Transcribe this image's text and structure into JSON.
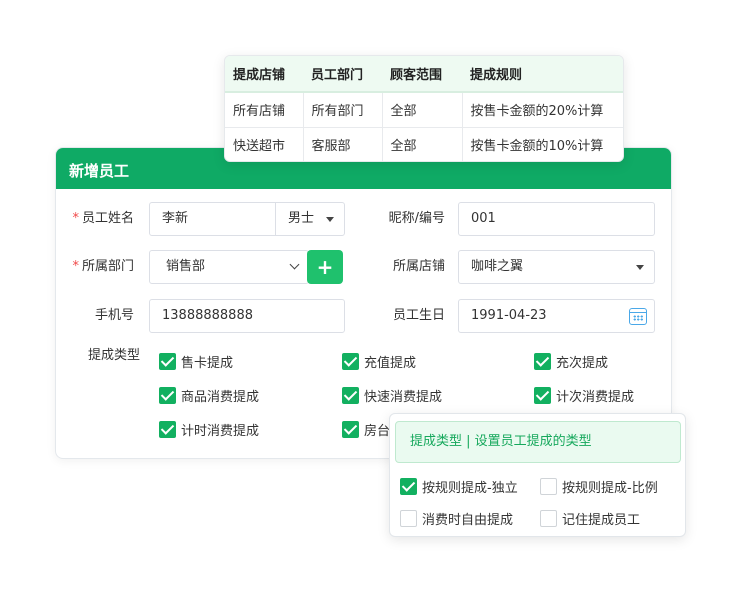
{
  "rules_table": {
    "headers": [
      "提成店铺",
      "员工部门",
      "顾客范围",
      "提成规则"
    ],
    "rows": [
      [
        "所有店铺",
        "所有部门",
        "全部",
        "按售卡金额的20%计算"
      ],
      [
        "快送超市",
        "客服部",
        "全部",
        "按售卡金额的10%计算"
      ]
    ]
  },
  "form": {
    "title": "新增员工",
    "required_mark": "*",
    "name_label": "员工姓名",
    "name_value": "李新",
    "gender_value": "男士",
    "nickname_label": "昵称/编号",
    "nickname_value": "001",
    "dept_label": "所属部门",
    "dept_value": "销售部",
    "add_dept_symbol": "+",
    "store_label": "所属店铺",
    "store_value": "咖啡之翼",
    "phone_label": "手机号",
    "phone_value": "13888888888",
    "birthday_label": "员工生日",
    "birthday_value": "1991-04-23",
    "commission_label": "提成类型",
    "commission_types": [
      {
        "label": "售卡提成",
        "checked": true
      },
      {
        "label": "充值提成",
        "checked": true
      },
      {
        "label": "充次提成",
        "checked": true
      },
      {
        "label": "商品消费提成",
        "checked": true
      },
      {
        "label": "快速消费提成",
        "checked": true
      },
      {
        "label": "计次消费提成",
        "checked": true
      },
      {
        "label": "计时消费提成",
        "checked": true
      },
      {
        "label": "房台",
        "checked": true
      }
    ]
  },
  "type_popup": {
    "header": "提成类型 | 设置员工提成的类型",
    "options": [
      {
        "label": "按规则提成-独立",
        "checked": true
      },
      {
        "label": "按规则提成-比例",
        "checked": false
      },
      {
        "label": "消费时自由提成",
        "checked": false
      },
      {
        "label": "记住提成员工",
        "checked": false
      }
    ]
  },
  "colors": {
    "primary": "#0faa65",
    "checkbox": "#12b060",
    "required": "#f04848"
  }
}
